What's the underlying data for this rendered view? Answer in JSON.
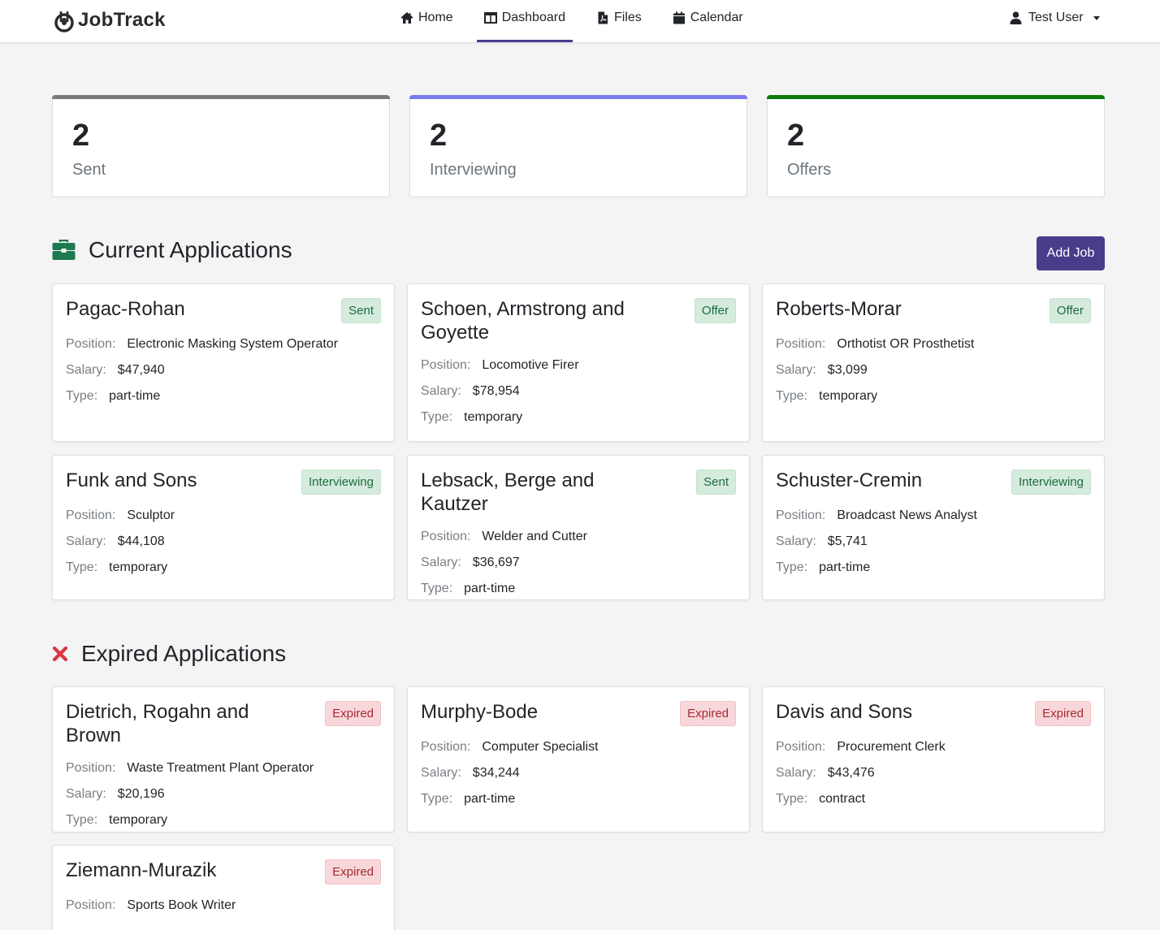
{
  "brand": {
    "name": "JobTrack"
  },
  "nav": {
    "links": [
      {
        "label": "Home",
        "icon": "home-icon"
      },
      {
        "label": "Dashboard",
        "icon": "columns-icon",
        "active": true
      },
      {
        "label": "Files",
        "icon": "file-pdf-icon"
      },
      {
        "label": "Calendar",
        "icon": "calendar-icon"
      }
    ],
    "user": "Test User"
  },
  "stats": [
    {
      "count": "2",
      "label": "Sent",
      "color": "#7a7a7a"
    },
    {
      "count": "2",
      "label": "Interviewing",
      "color": "#7b7bf0"
    },
    {
      "count": "2",
      "label": "Offers",
      "color": "#0a7a0a"
    }
  ],
  "current": {
    "title": "Current Applications",
    "add_label": "Add Job",
    "jobs": [
      {
        "company": "Pagac-Rohan",
        "status": "Sent",
        "position": "Electronic Masking System Operator",
        "salary": "$47,940",
        "type": "part-time"
      },
      {
        "company": "Schoen, Armstrong and Goyette",
        "status": "Offer",
        "position": "Locomotive Firer",
        "salary": "$78,954",
        "type": "temporary"
      },
      {
        "company": "Roberts-Morar",
        "status": "Offer",
        "position": "Orthotist OR Prosthetist",
        "salary": "$3,099",
        "type": "temporary"
      },
      {
        "company": "Funk and Sons",
        "status": "Interviewing",
        "position": "Sculptor",
        "salary": "$44,108",
        "type": "temporary"
      },
      {
        "company": "Lebsack, Berge and Kautzer",
        "status": "Sent",
        "position": "Welder and Cutter",
        "salary": "$36,697",
        "type": "part-time"
      },
      {
        "company": "Schuster-Cremin",
        "status": "Interviewing",
        "position": "Broadcast News Analyst",
        "salary": "$5,741",
        "type": "part-time"
      }
    ]
  },
  "expired": {
    "title": "Expired Applications",
    "jobs": [
      {
        "company": "Dietrich, Rogahn and Brown",
        "status": "Expired",
        "position": "Waste Treatment Plant Operator",
        "salary": "$20,196",
        "type": "temporary"
      },
      {
        "company": "Murphy-Bode",
        "status": "Expired",
        "position": "Computer Specialist",
        "salary": "$34,244",
        "type": "part-time"
      },
      {
        "company": "Davis and Sons",
        "status": "Expired",
        "position": "Procurement Clerk",
        "salary": "$43,476",
        "type": "contract"
      },
      {
        "company": "Ziemann-Murazik",
        "status": "Expired",
        "position": "Sports Book Writer",
        "salary": "",
        "type": ""
      }
    ]
  },
  "field_labels": {
    "position": "Position:",
    "salary": "Salary:",
    "type": "Type:"
  }
}
